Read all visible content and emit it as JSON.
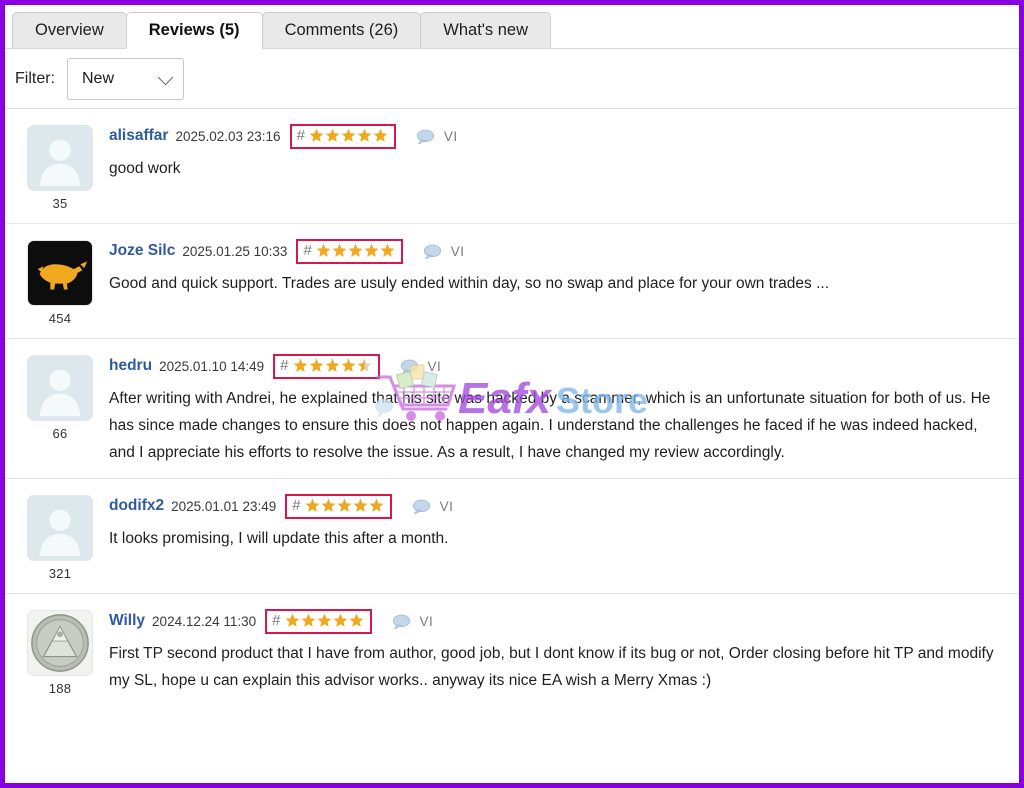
{
  "theme": {
    "page_border": "#8800e0",
    "link_color": "#2f5b9e",
    "rating_box_border": "#d6194a",
    "star_color": "#f0a81e",
    "star_empty": "#d9d4c8",
    "watermark_purple": "#a24bdd",
    "watermark_blue": "#7fb7e8"
  },
  "tabs": [
    {
      "label": "Overview",
      "active": false
    },
    {
      "label": "Reviews (5)",
      "active": true
    },
    {
      "label": "Comments (26)",
      "active": false
    },
    {
      "label": "What's new",
      "active": false
    }
  ],
  "filter": {
    "label": "Filter:",
    "selected": "New",
    "options": [
      "New"
    ],
    "caret_icon": "chevron-down-icon"
  },
  "icons": {
    "comment_bubble": "speech-bubble-icon",
    "hash": "#",
    "vi": "VI"
  },
  "watermark": {
    "text_primary": "Eafx",
    "text_secondary": "Store",
    "cart_icon": "shopping-cart-icon"
  },
  "reviews": [
    {
      "username": "alisaffar",
      "timestamp": "2025.02.03 23:16",
      "rating": 5,
      "reputation": "35",
      "avatar_type": "default-person",
      "vi": "VI",
      "text": "good work"
    },
    {
      "username": "Joze Silc",
      "timestamp": "2025.01.25 10:33",
      "rating": 5,
      "reputation": "454",
      "avatar_type": "bull",
      "vi": "VI",
      "text": "Good and quick support. Trades are usuly ended within day, so no swap and place for your own trades ..."
    },
    {
      "username": "hedru",
      "timestamp": "2025.01.10 14:49",
      "rating": 4.5,
      "reputation": "66",
      "avatar_type": "default-person",
      "vi": "VI",
      "text": "After writing with Andrei, he explained that his site was hacked by a scammer, which is an unfortunate situation for both of us. He has since made changes to ensure this does not happen again. I understand the challenges he faced if he was indeed hacked, and I appreciate his efforts to resolve the issue. As a result, I have changed my review accordingly."
    },
    {
      "username": "dodifx2",
      "timestamp": "2025.01.01 23:49",
      "rating": 5,
      "reputation": "321",
      "avatar_type": "default-person",
      "vi": "VI",
      "text": "It looks promising, I will update this after a month."
    },
    {
      "username": "Willy",
      "timestamp": "2024.12.24 11:30",
      "rating": 5,
      "reputation": "188",
      "avatar_type": "coin-pyramid",
      "vi": "VI",
      "text": "First TP second product that I have from author, good job, but I dont know if its bug or not, Order closing before hit TP and modify my SL, hope u can explain this advisor works.. anyway its nice EA wish a Merry Xmas :)"
    }
  ]
}
